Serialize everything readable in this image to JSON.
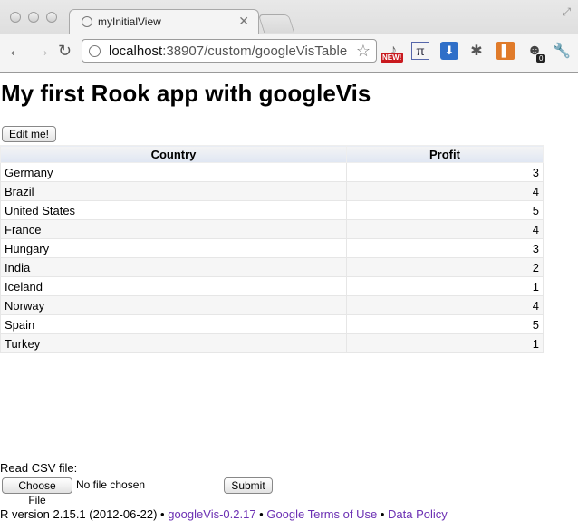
{
  "browser": {
    "tab_title": "myInitialView",
    "url_host": "localhost",
    "url_path": ":38907/custom/googleVisTable",
    "new_badge": "NEW!",
    "count_badge": "0"
  },
  "page": {
    "heading": "My first Rook app with googleVis",
    "edit_button": "Edit me!",
    "table": {
      "headers": [
        "Country",
        "Profit"
      ],
      "rows": [
        {
          "country": "Germany",
          "profit": "3"
        },
        {
          "country": "Brazil",
          "profit": "4"
        },
        {
          "country": "United States",
          "profit": "5"
        },
        {
          "country": "France",
          "profit": "4"
        },
        {
          "country": "Hungary",
          "profit": "3"
        },
        {
          "country": "India",
          "profit": "2"
        },
        {
          "country": "Iceland",
          "profit": "1"
        },
        {
          "country": "Norway",
          "profit": "4"
        },
        {
          "country": "Spain",
          "profit": "5"
        },
        {
          "country": "Turkey",
          "profit": "1"
        }
      ]
    },
    "csv_label": "Read CSV file:",
    "choose_file_button": "Choose File",
    "no_file_text": "No file chosen",
    "submit_button": "Submit"
  },
  "footer": {
    "r_version": "R version 2.15.1 (2012-06-22)",
    "separator": " • ",
    "link_googlevis": "googleVis-0.2.17",
    "link_terms": "Google Terms of Use",
    "link_policy": "Data Policy"
  },
  "colors": {
    "link": "#6b2fb3",
    "header_gradient_end": "#dfe6f3"
  }
}
